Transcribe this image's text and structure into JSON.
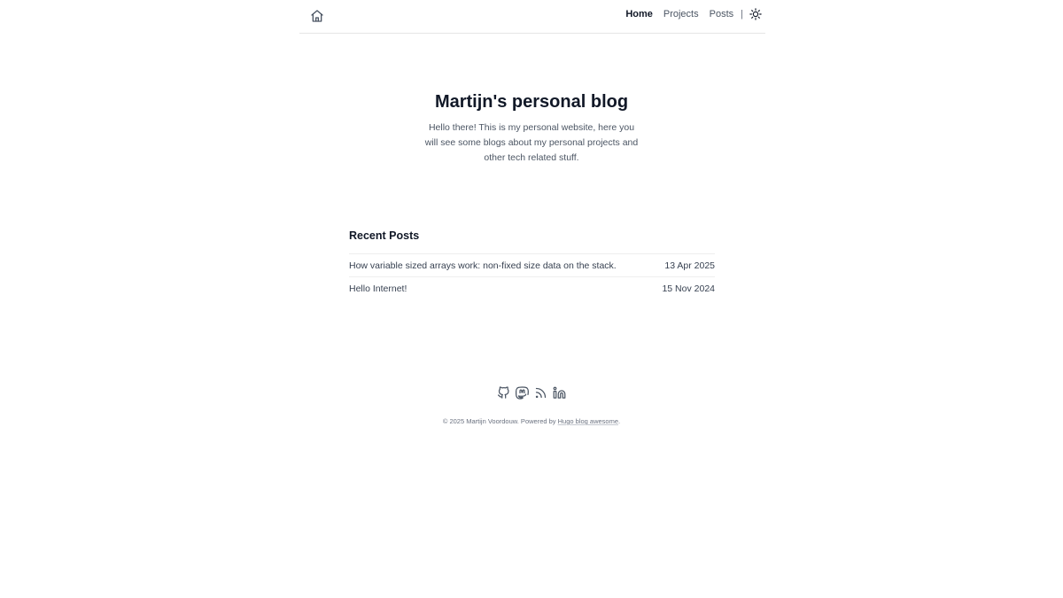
{
  "header": {
    "home_icon": "home-icon",
    "nav": [
      {
        "label": "Home",
        "active": true
      },
      {
        "label": "Projects",
        "active": false
      },
      {
        "label": "Posts",
        "active": false
      }
    ],
    "separator": "|",
    "theme_icon": "sun-icon"
  },
  "hero": {
    "title": "Martijn's personal blog",
    "description": "Hello there! This is my personal website, here you will see some blogs about my personal projects and other tech related stuff."
  },
  "recent_posts": {
    "heading": "Recent Posts",
    "items": [
      {
        "title": "How variable sized arrays work: non-fixed size data on the stack.",
        "date": "13 Apr 2025"
      },
      {
        "title": "Hello Internet!",
        "date": "15 Nov 2024"
      }
    ]
  },
  "footer": {
    "social_icons": [
      "github-icon",
      "mastodon-icon",
      "rss-icon",
      "linkedin-icon"
    ],
    "copyright_prefix": "© 2025 Martijn Voordouw. Powered by ",
    "powered_link": "Hugo blog awesome",
    "copyright_suffix": "."
  },
  "colors": {
    "text": "#111827",
    "muted": "#4b5563",
    "border": "#e6e6e6"
  }
}
